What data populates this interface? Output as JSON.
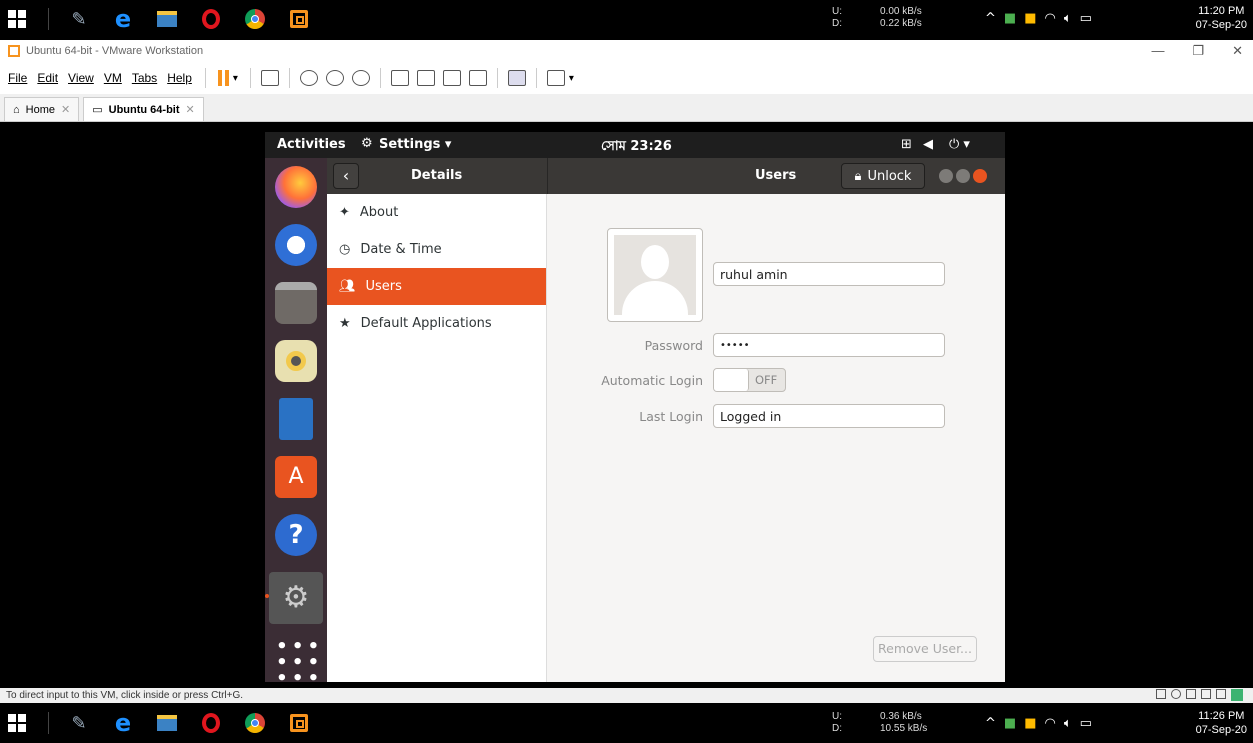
{
  "host_taskbar_top": {
    "net_up_label": "U:",
    "net_down_label": "D:",
    "net_up": "0.00 kB/s",
    "net_down": "0.22 kB/s",
    "time": "11:20 PM",
    "date": "07-Sep-20"
  },
  "host_taskbar_bottom": {
    "net_up_label": "U:",
    "net_down_label": "D:",
    "net_up": "0.36 kB/s",
    "net_down": "10.55 kB/s",
    "time": "11:26 PM",
    "date": "07-Sep-20"
  },
  "vmware": {
    "title": "Ubuntu 64-bit - VMware Workstation",
    "menu": [
      "File",
      "Edit",
      "View",
      "VM",
      "Tabs",
      "Help"
    ],
    "tabs": [
      {
        "label": "Home"
      },
      {
        "label": "Ubuntu 64-bit"
      }
    ],
    "status_text": "To direct input to this VM, click inside or press Ctrl+G."
  },
  "gnome": {
    "activities": "Activities",
    "app_menu": "Settings ▾",
    "clock": "সোম 23:26",
    "tray": "⏻ ▾"
  },
  "settings": {
    "sidebar_header": "Details",
    "panel_title": "Users",
    "unlock_label": "Unlock",
    "sidebar_items": [
      {
        "label": "About",
        "icon": "star-four-icon"
      },
      {
        "label": "Date & Time",
        "icon": "clock-icon"
      },
      {
        "label": "Users",
        "icon": "users-icon",
        "active": true
      },
      {
        "label": "Default Applications",
        "icon": "star-icon"
      }
    ],
    "user": {
      "name": "ruhul amin",
      "password_label": "Password",
      "password_value": "•••••",
      "auto_login_label": "Automatic Login",
      "auto_login_state": "OFF",
      "last_login_label": "Last Login",
      "last_login_value": "Logged in"
    },
    "remove_user_label": "Remove User..."
  },
  "colors": {
    "accent": "#e95420",
    "dock": "#3b2d35",
    "headerbar": "#3a3836"
  }
}
